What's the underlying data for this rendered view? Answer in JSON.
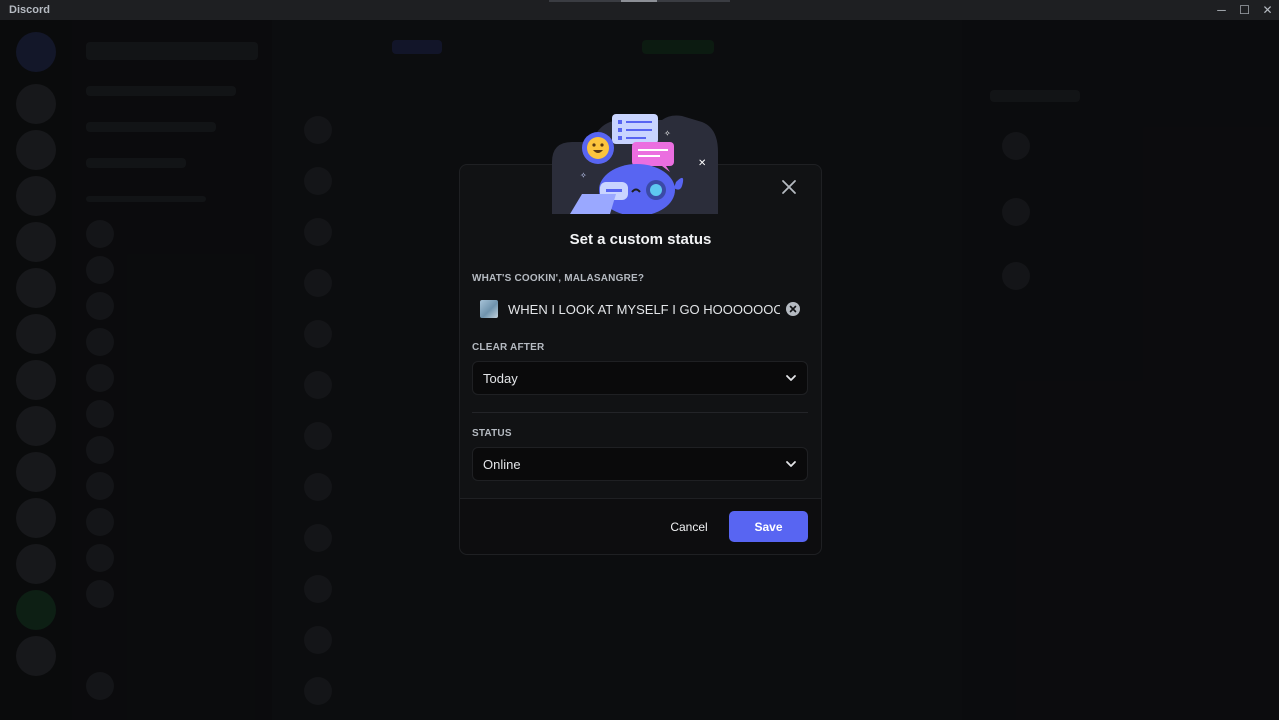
{
  "window": {
    "app_name": "Discord",
    "controls": {
      "minimize": "─",
      "maximize": "☐",
      "close": "✕"
    }
  },
  "modal": {
    "title": "Set a custom status",
    "status_field": {
      "label": "WHAT'S COOKIN', MALASANGRE?",
      "value": "WHEN I LOOK AT MYSELF I GO HOOOOOOOOO",
      "emoji_icon": "custom-emoji-thumbnail",
      "clear_icon": "clear-circle-icon"
    },
    "clear_after": {
      "label": "CLEAR AFTER",
      "selected": "Today"
    },
    "status": {
      "label": "STATUS",
      "selected": "Online"
    },
    "buttons": {
      "cancel": "Cancel",
      "save": "Save"
    }
  },
  "colors": {
    "accent": "#5865f2",
    "modal_bg": "#111214",
    "app_bg": "#0b0b0d"
  }
}
